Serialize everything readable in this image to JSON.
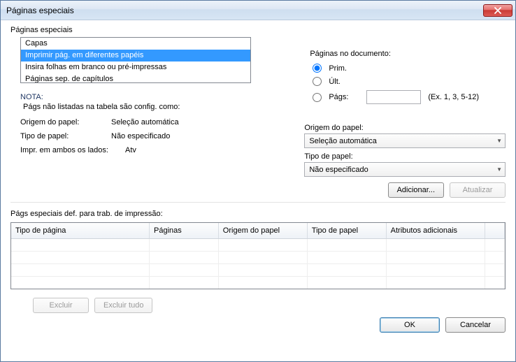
{
  "window": {
    "title": "Páginas especiais"
  },
  "group_label": "Páginas especiais",
  "list": {
    "items": [
      {
        "label": "Capas",
        "selected": false
      },
      {
        "label": "Imprimir pág. em diferentes papéis",
        "selected": true
      },
      {
        "label": "Insira folhas em branco ou pré-impressas",
        "selected": false
      },
      {
        "label": "Páginas sep. de capítulos",
        "selected": false
      }
    ]
  },
  "nota": {
    "title": "NOTA:",
    "subtitle": "Págs não listadas na tabela são config. como:",
    "rows": [
      {
        "k": "Origem do papel:",
        "v": "Seleção automática"
      },
      {
        "k": "Tipo de papel:",
        "v": "Não especificado"
      },
      {
        "k": "Impr. em ambos os lados:",
        "v": "Atv"
      }
    ]
  },
  "pages_doc": {
    "header": "Páginas no documento:",
    "options": {
      "prim": "Prim.",
      "ult": "Últ.",
      "pags": "Págs:"
    },
    "selected": "prim",
    "input_value": "",
    "hint": "(Ex. 1, 3, 5-12)"
  },
  "paper": {
    "source_label": "Origem do papel:",
    "source_value": "Seleção automática",
    "type_label": "Tipo de papel:",
    "type_value": "Não especificado"
  },
  "buttons": {
    "add": "Adicionar...",
    "update": "Atualizar",
    "delete": "Excluir",
    "delete_all": "Excluir tudo",
    "ok": "OK",
    "cancel": "Cancelar"
  },
  "table": {
    "label": "Págs especiais def. para trab. de impressão:",
    "columns": [
      "Tipo de página",
      "Páginas",
      "Origem do papel",
      "Tipo de papel",
      "Atributos adicionais"
    ],
    "rows": []
  }
}
